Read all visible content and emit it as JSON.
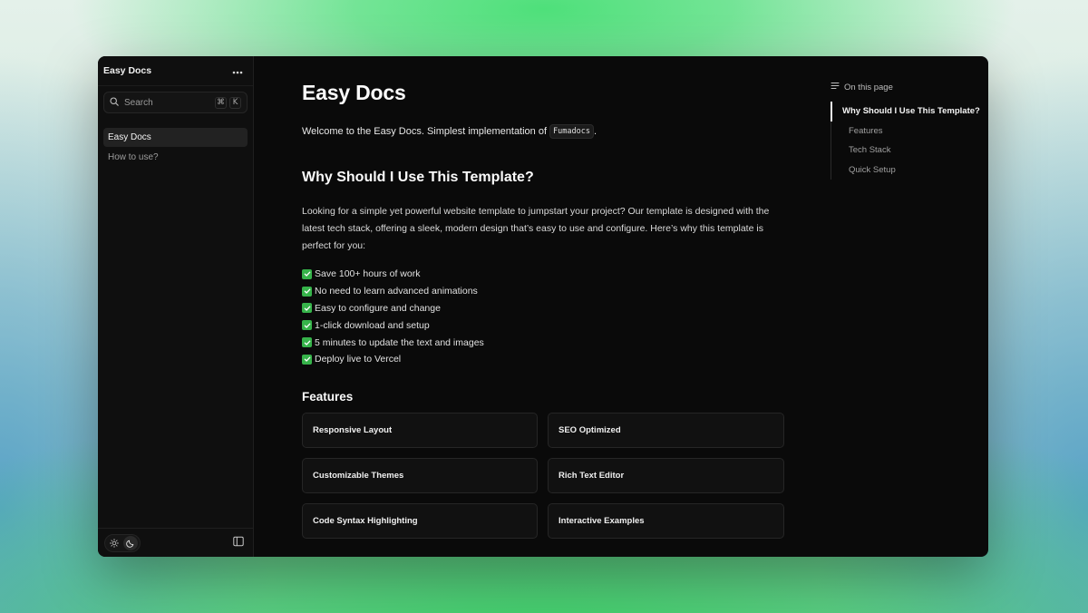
{
  "sidebar": {
    "title": "Easy Docs",
    "menu_icon": "more-horizontal-icon",
    "search": {
      "label": "Search",
      "kbd": [
        "⌘",
        "K"
      ]
    },
    "items": [
      {
        "label": "Easy Docs",
        "active": true
      },
      {
        "label": "How to use?",
        "active": false
      }
    ],
    "footer": {
      "theme": [
        "sun-icon",
        "moon-icon"
      ],
      "collapse_icon": "sidebar-icon"
    }
  },
  "main": {
    "title": "Easy Docs",
    "intro": "Welcome to the Easy Docs. Simplest implementation of",
    "intro_code": "Fumadocs",
    "intro_end": ".",
    "section1": {
      "title": "Why Should I Use This Template?",
      "paragraph": "Looking for a simple yet powerful website template to jumpstart your project? Our template is designed with the latest tech stack, offering a sleek, modern design that’s easy to use and configure. Here’s why this template is perfect for you:",
      "checklist": [
        "Save 100+ hours of work",
        "No need to learn advanced animations",
        "Easy to configure and change",
        "1-click download and setup",
        "5 minutes to update the text and images",
        "Deploy live to Vercel"
      ]
    },
    "features": {
      "title": "Features",
      "cards": [
        "Responsive Layout",
        "SEO Optimized",
        "Customizable Themes",
        "Rich Text Editor",
        "Code Syntax Highlighting",
        "Interactive Examples"
      ]
    }
  },
  "toc": {
    "heading": "On this page",
    "items": [
      {
        "label": "Why Should I Use This Template?",
        "active": true
      },
      {
        "label": "Features",
        "active": false
      },
      {
        "label": "Tech Stack",
        "active": false
      },
      {
        "label": "Quick Setup",
        "active": false
      }
    ]
  },
  "colors": {
    "accent": "#36b34a",
    "background": "#0a0a0a"
  }
}
